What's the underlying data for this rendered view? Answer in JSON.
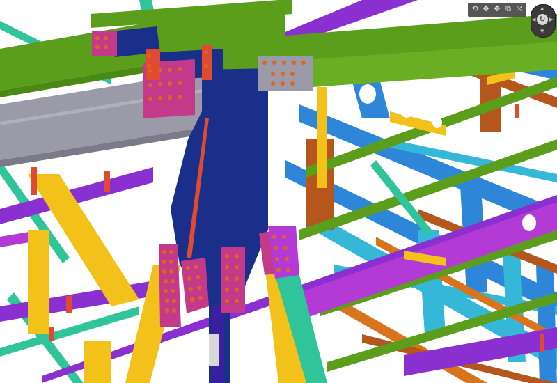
{
  "viewer": {
    "background": "#ffffff",
    "palette": {
      "green": "#5a9e1c",
      "grey": "#9a9aa8",
      "navy": "#1a2f8a",
      "purple": "#8a2fd0",
      "magenta": "#b43ad6",
      "blue": "#2e86d9",
      "cyan": "#35b8d8",
      "yellow": "#f2c21a",
      "orange": "#d8741c",
      "brown": "#b5561c",
      "teal": "#2fc49a",
      "red": "#e04a30",
      "bolt": "#e0641e",
      "plate": "#c43a8a"
    }
  },
  "toolbar": {
    "icons": [
      "orbit-icon",
      "pan-icon",
      "move-icon",
      "zoom-window-icon",
      "fit-all-icon"
    ],
    "glyphs": [
      "⟲",
      "✥",
      "✥",
      "⧉",
      "⤧"
    ]
  },
  "nav_control": {
    "icon": "navigation-wheel-icon",
    "glyph": "↻"
  }
}
